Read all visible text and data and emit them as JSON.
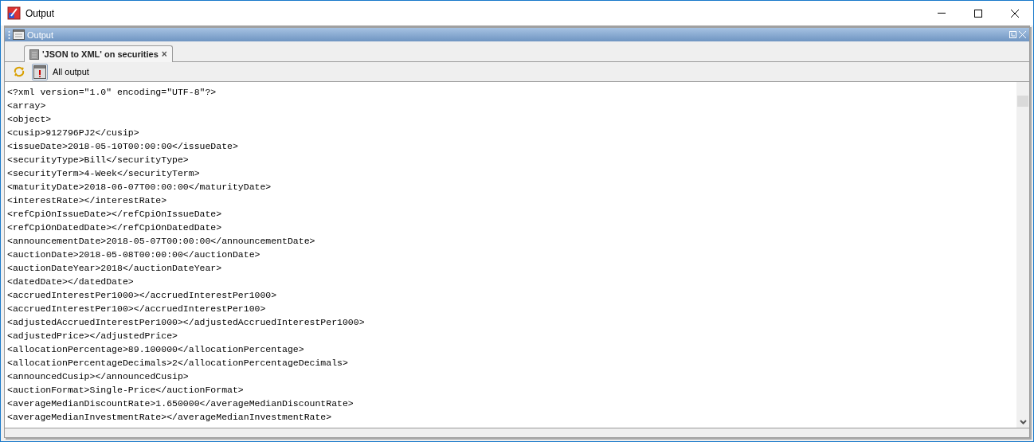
{
  "window": {
    "title": "Output"
  },
  "panel": {
    "title": "Output"
  },
  "tabs": [
    {
      "label": "'JSON to XML' on securities",
      "selected": true,
      "close": "×"
    }
  ],
  "toolbar": {
    "label": "All output"
  },
  "output_lines": [
    "<?xml version=\"1.0\" encoding=\"UTF-8\"?>",
    "<array>",
    "<object>",
    "<cusip>912796PJ2</cusip>",
    "<issueDate>2018-05-10T00:00:00</issueDate>",
    "<securityType>Bill</securityType>",
    "<securityTerm>4-Week</securityTerm>",
    "<maturityDate>2018-06-07T00:00:00</maturityDate>",
    "<interestRate></interestRate>",
    "<refCpiOnIssueDate></refCpiOnIssueDate>",
    "<refCpiOnDatedDate></refCpiOnDatedDate>",
    "<announcementDate>2018-05-07T00:00:00</announcementDate>",
    "<auctionDate>2018-05-08T00:00:00</auctionDate>",
    "<auctionDateYear>2018</auctionDateYear>",
    "<datedDate></datedDate>",
    "<accruedInterestPer1000></accruedInterestPer1000>",
    "<accruedInterestPer100></accruedInterestPer100>",
    "<adjustedAccruedInterestPer1000></adjustedAccruedInterestPer1000>",
    "<adjustedPrice></adjustedPrice>",
    "<allocationPercentage>89.100000</allocationPercentage>",
    "<allocationPercentageDecimals>2</allocationPercentageDecimals>",
    "<announcedCusip></announcedCusip>",
    "<auctionFormat>Single-Price</auctionFormat>",
    "<averageMedianDiscountRate>1.650000</averageMedianDiscountRate>",
    "<averageMedianInvestmentRate></averageMedianInvestmentRate>"
  ]
}
